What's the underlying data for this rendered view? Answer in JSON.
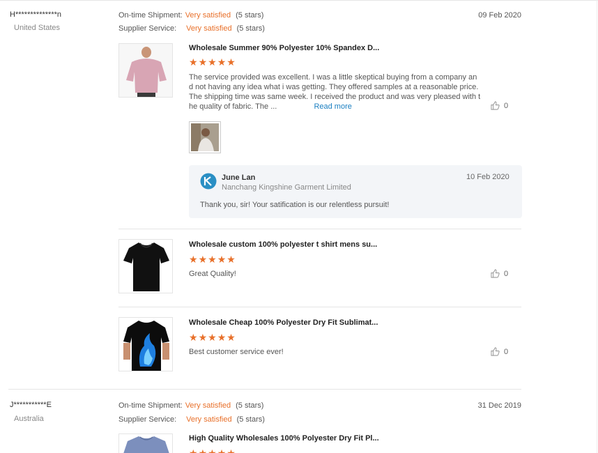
{
  "reviews": [
    {
      "buyer": "H**************n",
      "country": "United States",
      "date": "09 Feb 2020",
      "ratings": [
        {
          "label": "On-time Shipment:",
          "value": "Very satisfied",
          "stars": "(5 stars)"
        },
        {
          "label": "Supplier Service:",
          "value": "Very satisfied",
          "stars": "(5 stars)"
        }
      ],
      "products": [
        {
          "title": "Wholesale Summer 90% Polyester 10% Spandex D...",
          "rating": 5,
          "text_lines": [
            "The service provided was excellent. I was a little skeptical buying from a company an",
            "d not having any idea what i was getting. They offered samples at a reasonable price.",
            "The shipping time was same week. I received the product and was very pleased with t",
            "he quality of fabric. The ..."
          ],
          "read_more": "Read more",
          "likes": "0",
          "reply": {
            "name": "June Lan",
            "company": "Nanchang Kingshine Garment Limited",
            "date": "10 Feb 2020",
            "text": "Thank you, sir! Your satification is our relentless pursuit!"
          }
        },
        {
          "title": "Wholesale custom 100% polyester t shirt mens su...",
          "rating": 5,
          "text": "Great Quality!",
          "likes": "0"
        },
        {
          "title": "Wholesale Cheap 100% Polyester Dry Fit Sublimat...",
          "rating": 5,
          "text": "Best customer service ever!",
          "likes": "0"
        }
      ]
    },
    {
      "buyer": "J***********E",
      "country": "Australia",
      "date": "31 Dec 2019",
      "ratings": [
        {
          "label": "On-time Shipment:",
          "value": "Very satisfied",
          "stars": "(5 stars)"
        },
        {
          "label": "Supplier Service:",
          "value": "Very satisfied",
          "stars": "(5 stars)"
        }
      ],
      "products": [
        {
          "title": "High Quality Wholesales 100% Polyester Dry Fit Pl...",
          "rating": 5
        }
      ]
    }
  ],
  "icons": {
    "star": "star-icon",
    "like": "thumbs-up-icon",
    "logo": "supplier-logo-icon"
  },
  "colors": {
    "accent": "#e8702a",
    "link": "#1a7fc1",
    "reply_bg": "#f3f5f8"
  }
}
